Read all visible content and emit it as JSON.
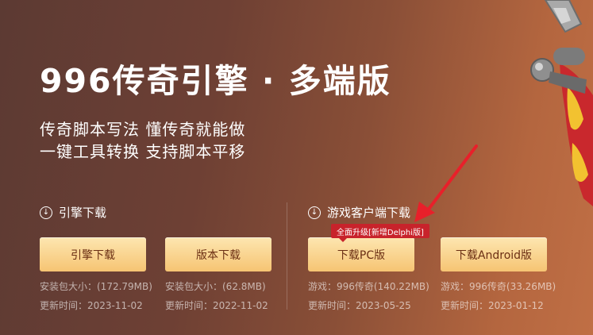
{
  "hero": {
    "title": "996传奇引擎 · 多端版",
    "tagline_1": "传奇脚本写法 懂传奇就能做",
    "tagline_2": "一键工具转换 支持脚本平移"
  },
  "engine_download": {
    "heading": "引擎下载",
    "buttons": [
      {
        "label": "引擎下载",
        "size": "安装包大小：(172.79MB)",
        "updated": "更新时间：2023-11-02"
      },
      {
        "label": "版本下载",
        "size": "安装包大小：(62.8MB)",
        "updated": "更新时间：2022-11-02"
      }
    ]
  },
  "client_download": {
    "heading": "游戏客户端下载",
    "badge": "全面升级[新增Delphi版]",
    "buttons": [
      {
        "label": "下载PC版",
        "size": "游戏：996传奇(140.22MB)",
        "updated": "更新时间：2023-05-25"
      },
      {
        "label": "下载Android版",
        "size": "游戏：996传奇(33.26MB)",
        "updated": "更新时间：2023-01-12"
      }
    ]
  },
  "colors": {
    "button_top": "#fde6b0",
    "button_bottom": "#f6c473",
    "button_text": "#6b2f14",
    "badge": "#c8232b",
    "arrow": "#e8202a"
  },
  "icons": {
    "section_icon": "download-circle-icon",
    "art": "sword-banner-art"
  }
}
